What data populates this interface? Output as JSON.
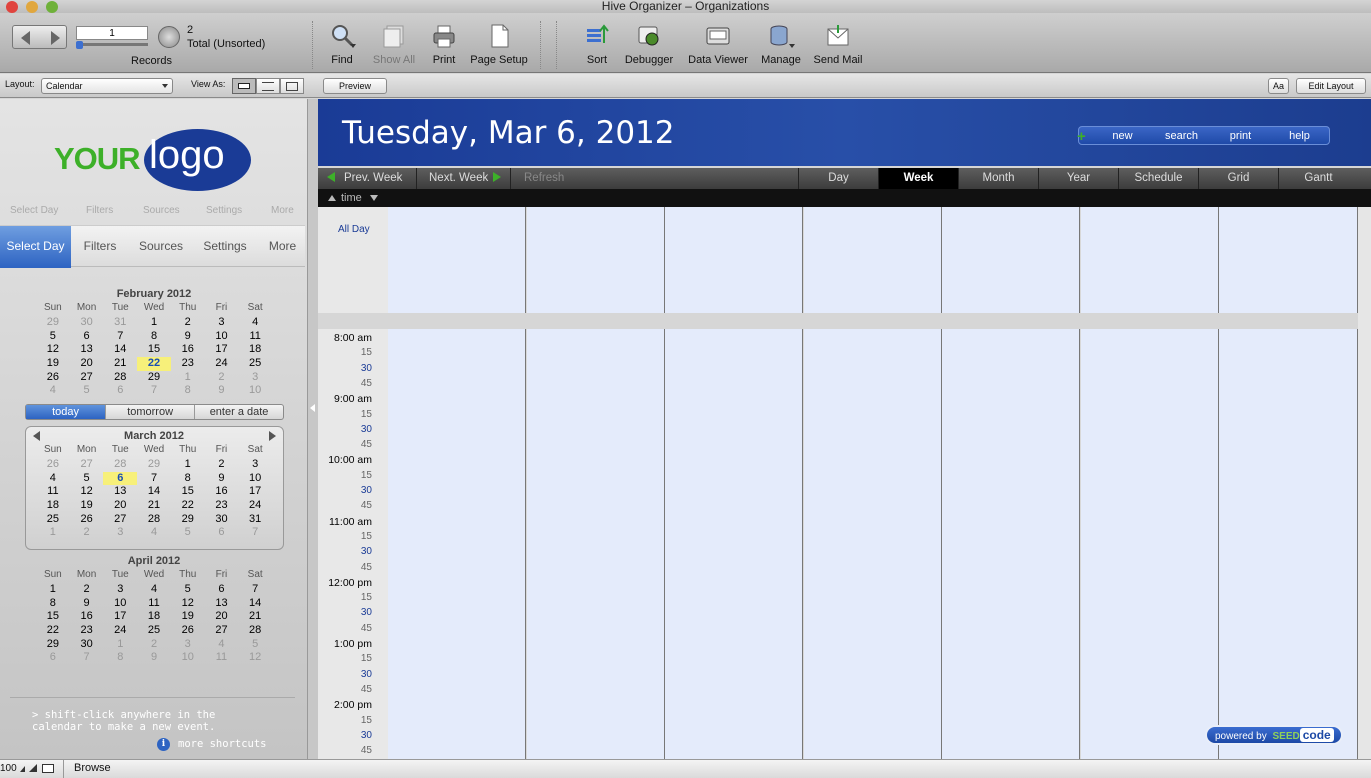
{
  "window": {
    "title": "Hive Organizer – Organizations"
  },
  "toolbar": {
    "record_number": "1",
    "records_label": "Records",
    "record_count": "2",
    "record_status": "Total (Unsorted)",
    "buttons": [
      {
        "label": "Find",
        "icon": "magnifier-icon"
      },
      {
        "label": "Show All",
        "icon": "show-all-icon"
      },
      {
        "label": "Print",
        "icon": "printer-icon"
      },
      {
        "label": "Page Setup",
        "icon": "page-setup-icon"
      },
      {
        "label": "Sort",
        "icon": "sort-icon"
      },
      {
        "label": "Debugger",
        "icon": "debugger-icon"
      },
      {
        "label": "Data Viewer",
        "icon": "data-viewer-icon"
      },
      {
        "label": "Manage",
        "icon": "database-icon"
      },
      {
        "label": "Send Mail",
        "icon": "mail-icon"
      }
    ]
  },
  "layoutbar": {
    "layout_label": "Layout:",
    "layout_value": "Calendar",
    "view_as_label": "View As:",
    "preview_label": "Preview",
    "aa_label": "Aa",
    "edit_layout_label": "Edit Layout"
  },
  "sidebar": {
    "logo": {
      "your": "YOUR",
      "logo": "logo"
    },
    "tabs": [
      "Select Day",
      "Filters",
      "Sources",
      "Settings",
      "More"
    ],
    "active_tab": "Select Day",
    "feb": {
      "title": "February 2012",
      "dow": [
        "Sun",
        "Mon",
        "Tue",
        "Wed",
        "Thu",
        "Fri",
        "Sat"
      ],
      "weeks": [
        [
          "29",
          "30",
          "31",
          "1",
          "2",
          "3",
          "4"
        ],
        [
          "5",
          "6",
          "7",
          "8",
          "9",
          "10",
          "11"
        ],
        [
          "12",
          "13",
          "14",
          "15",
          "16",
          "17",
          "18"
        ],
        [
          "19",
          "20",
          "21",
          "22",
          "23",
          "24",
          "25"
        ],
        [
          "26",
          "27",
          "28",
          "29",
          "1",
          "2",
          "3"
        ],
        [
          "4",
          "5",
          "6",
          "7",
          "8",
          "9",
          "10"
        ]
      ]
    },
    "quick": {
      "today": "today",
      "tomorrow": "tomorrow",
      "enter": "enter a date"
    },
    "mar": {
      "title": "March 2012",
      "dow": [
        "Sun",
        "Mon",
        "Tue",
        "Wed",
        "Thu",
        "Fri",
        "Sat"
      ],
      "weeks": [
        [
          "26",
          "27",
          "28",
          "29",
          "1",
          "2",
          "3"
        ],
        [
          "4",
          "5",
          "6",
          "7",
          "8",
          "9",
          "10"
        ],
        [
          "11",
          "12",
          "13",
          "14",
          "15",
          "16",
          "17"
        ],
        [
          "18",
          "19",
          "20",
          "21",
          "22",
          "23",
          "24"
        ],
        [
          "25",
          "26",
          "27",
          "28",
          "29",
          "30",
          "31"
        ],
        [
          "1",
          "2",
          "3",
          "4",
          "5",
          "6",
          "7"
        ]
      ]
    },
    "apr": {
      "title": "April 2012",
      "dow": [
        "Sun",
        "Mon",
        "Tue",
        "Wed",
        "Thu",
        "Fri",
        "Sat"
      ],
      "weeks": [
        [
          "1",
          "2",
          "3",
          "4",
          "5",
          "6",
          "7"
        ],
        [
          "8",
          "9",
          "10",
          "11",
          "12",
          "13",
          "14"
        ],
        [
          "15",
          "16",
          "17",
          "18",
          "19",
          "20",
          "21"
        ],
        [
          "22",
          "23",
          "24",
          "25",
          "26",
          "27",
          "28"
        ],
        [
          "29",
          "30",
          "1",
          "2",
          "3",
          "4",
          "5"
        ],
        [
          "6",
          "7",
          "8",
          "9",
          "10",
          "11",
          "12"
        ]
      ]
    },
    "hint": "> shift-click anywhere in the calendar to make a new event.",
    "more_shortcuts": "more shortcuts"
  },
  "main": {
    "date_title": "Tuesday, Mar 6, 2012",
    "header_links": [
      "new",
      "search",
      "print",
      "help"
    ],
    "nav": {
      "prev": "Prev. Week",
      "next": "Next. Week",
      "refresh": "Refresh"
    },
    "views": [
      "Day",
      "Week",
      "Month",
      "Year",
      "Schedule",
      "Grid",
      "Gantt"
    ],
    "active_view": "Week",
    "time_label": "time",
    "all_day_label": "All Day",
    "time_slots": [
      "8:00 am",
      "15",
      "30",
      "45",
      "9:00 am",
      "15",
      "30",
      "45",
      "10:00 am",
      "15",
      "30",
      "45",
      "11:00 am",
      "15",
      "30",
      "45",
      "12:00 pm",
      "15",
      "30",
      "45",
      "1:00 pm",
      "15",
      "30",
      "45",
      "2:00 pm",
      "15",
      "30",
      "45"
    ],
    "badge": {
      "powered": "powered by",
      "seed": "SEED",
      "code": "code"
    }
  },
  "statusbar": {
    "zoom": "100",
    "mode": "Browse"
  },
  "colors": {
    "header_blue": "#1a3b96",
    "day_fill": "#e4ebfb",
    "today_highlight": "#f7f07a",
    "tab_active": "#2d63c2"
  }
}
